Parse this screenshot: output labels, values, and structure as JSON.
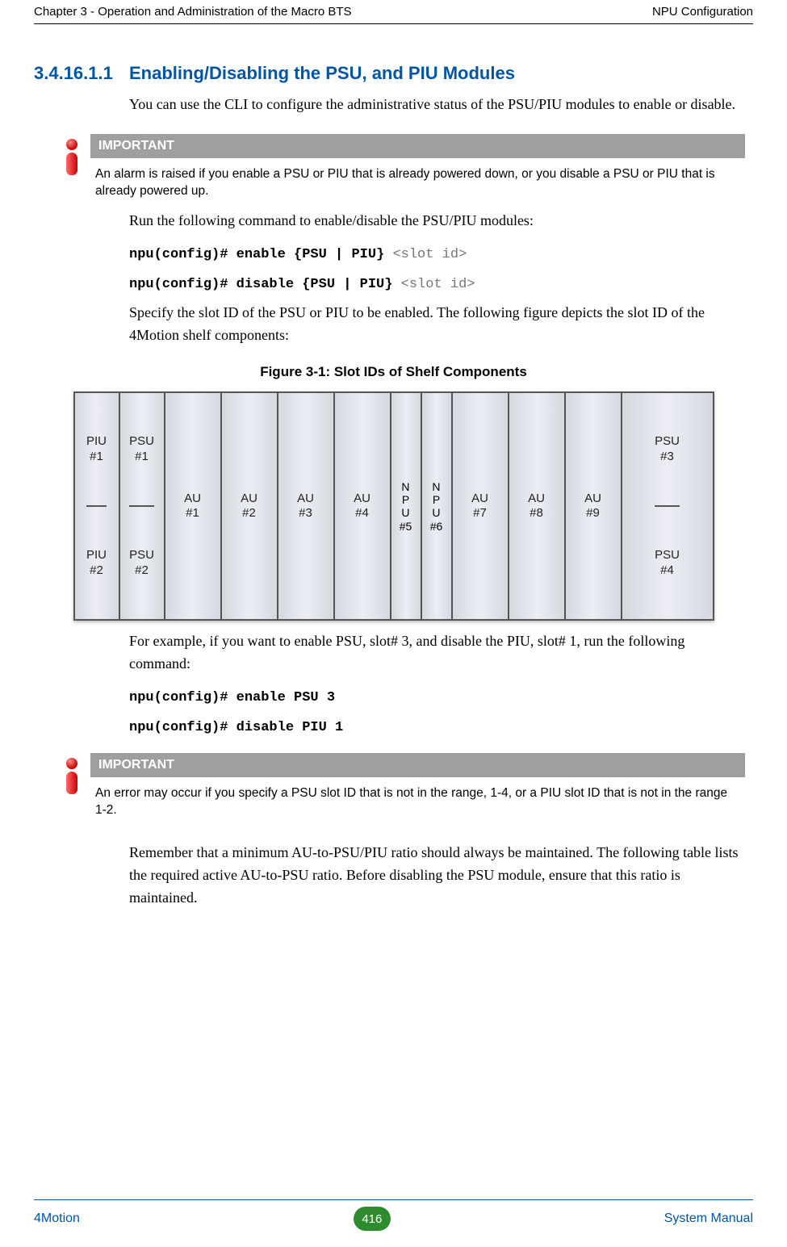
{
  "header": {
    "left": "Chapter 3 - Operation and Administration of the Macro BTS",
    "right": "NPU Configuration"
  },
  "section": {
    "number": "3.4.16.1.1",
    "title": "Enabling/Disabling the PSU, and PIU Modules"
  },
  "p1": "You can use the CLI to configure the administrative status of the PSU/PIU modules to enable or disable.",
  "important1": {
    "label": "IMPORTANT",
    "text": "An alarm is raised if you enable a PSU or PIU that is already powered down, or you disable a PSU or PIU that is already powered up."
  },
  "p2": "Run the following command to enable/disable the PSU/PIU modules:",
  "cmd1_bold": "npu(config)# enable {PSU | PIU} ",
  "cmd1_light": "<slot id>",
  "cmd2_bold": "npu(config)# disable {PSU | PIU} ",
  "cmd2_light": "<slot id>",
  "p3": "Specify the slot ID of the PSU or PIU to be enabled. The following figure depicts the slot ID of the 4Motion shelf components:",
  "figure_caption": "Figure 3-1: Slot IDs of Shelf Components",
  "shelf": {
    "piu1": "PIU\n#1",
    "piu2": "PIU\n#2",
    "psu1": "PSU\n#1",
    "psu2": "PSU\n#2",
    "au1": "AU\n#1",
    "au2": "AU\n#2",
    "au3": "AU\n#3",
    "au4": "AU\n#4",
    "npu5": "N\nP\nU\n#5",
    "npu6": "N\nP\nU\n#6",
    "au7": "AU\n#7",
    "au8": "AU\n#8",
    "au9": "AU\n#9",
    "psu3": "PSU\n#3",
    "psu4": "PSU\n#4"
  },
  "p4": "For example, if you want to enable PSU, slot# 3, and disable the PIU, slot# 1, run the following command:",
  "cmd3": "npu(config)# enable PSU 3",
  "cmd4": "npu(config)# disable PIU 1",
  "important2": {
    "label": "IMPORTANT",
    "text": "An error may occur if you specify a PSU slot ID that is not in the range, 1-4, or a PIU slot ID that is not in the range 1-2."
  },
  "p5": "Remember that a minimum AU-to-PSU/PIU ratio should always be maintained. The following table lists the required active AU-to-PSU ratio. Before disabling the PSU module, ensure that this ratio is maintained.",
  "footer": {
    "left": "4Motion",
    "page": "416",
    "right": "System Manual"
  }
}
